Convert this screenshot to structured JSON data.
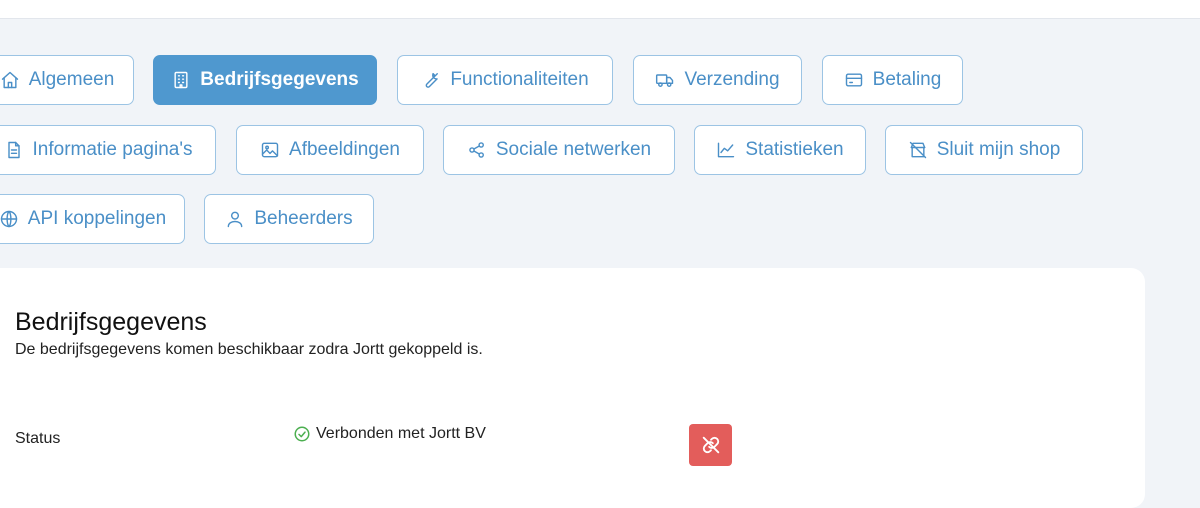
{
  "tabs": {
    "algemeen": "Algemeen",
    "bedrijfsgegevens": "Bedrijfsgegevens",
    "functionaliteiten": "Functionaliteiten",
    "verzending": "Verzending",
    "betaling": "Betaling",
    "informatie": "Informatie pagina's",
    "afbeeldingen": "Afbeeldingen",
    "sociale": "Sociale netwerken",
    "statistieken": "Statistieken",
    "sluit": "Sluit mijn shop",
    "api": "API koppelingen",
    "beheerders": "Beheerders"
  },
  "active_tab": "Bedrijfsgegevens",
  "card": {
    "title": "Bedrijfsgegevens",
    "description": "De bedrijfsgegevens komen beschikbaar zodra Jortt gekoppeld is.",
    "status_label": "Status",
    "status_value": "Verbonden met Jortt BV"
  },
  "colors": {
    "accent": "#4f98cf",
    "tab_border": "#9cc4e4",
    "tab_text": "#4a8fc7",
    "success": "#4caf50",
    "danger": "#e35d5b",
    "background": "#f1f4f8"
  }
}
